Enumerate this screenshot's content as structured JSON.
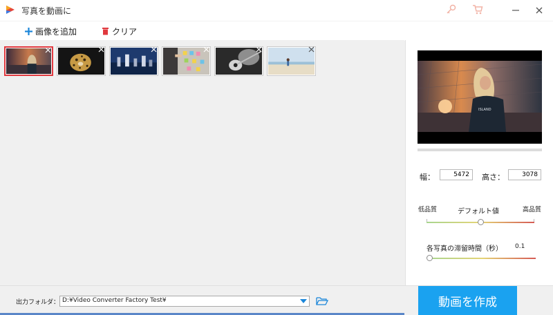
{
  "window": {
    "title": "写真を動画に",
    "icons": [
      "app-logo-icon",
      "key-icon",
      "cart-icon",
      "minimize-icon",
      "close-icon"
    ]
  },
  "toolbar": {
    "add_label": "画像を追加",
    "clear_label": "クリア"
  },
  "gallery": {
    "thumbnails": [
      {
        "subject": "girl-at-sunset",
        "selected": true
      },
      {
        "subject": "leopard",
        "selected": false
      },
      {
        "subject": "chess-pieces",
        "selected": false
      },
      {
        "subject": "sticky-notes-board",
        "selected": false
      },
      {
        "subject": "guitar-player",
        "selected": false
      },
      {
        "subject": "child-on-beach",
        "selected": false
      }
    ]
  },
  "settings": {
    "width_label": "幅：",
    "width_value": "5472",
    "height_label": "高さ：",
    "height_value": "3078",
    "quality_low": "低品質",
    "quality_default": "デフォルト値",
    "quality_high": "高品質",
    "quality_level": 0.5,
    "duration_label": "各写真の滞留時間（秒）",
    "duration_value": "0.1",
    "duration_level": 0.0
  },
  "output": {
    "folder_label": "出力フォルダ：",
    "folder_path": "D:¥Video Converter Factory Test¥",
    "create_label": "動画を作成"
  },
  "colors": {
    "accent": "#1aa2f0",
    "selected_border": "#e0383e",
    "clear_icon": "#e0383e",
    "add_icon": "#1b86d9"
  }
}
